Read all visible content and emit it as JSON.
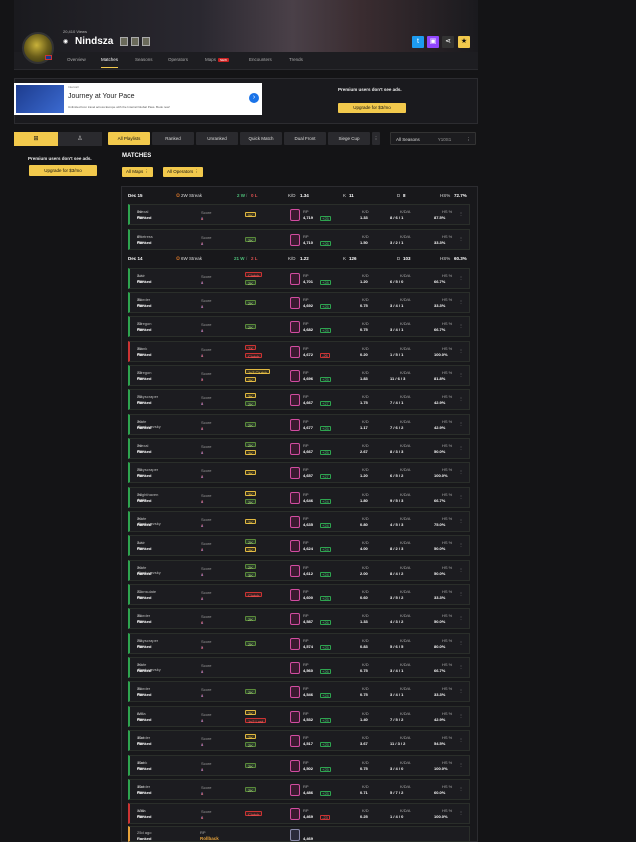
{
  "profile": {
    "views": "20,410 Views",
    "username": "Nindsza",
    "platform_icon": "ubisoft-icon"
  },
  "tabs": [
    "Overview",
    "Matches",
    "Seasons",
    "Operators",
    "Maps",
    "Encounters",
    "Trends"
  ],
  "tab_new_badge": "NEW",
  "ad": {
    "sponsor": "Intercall",
    "headline": "Journey at Your Pace",
    "body": "Unlimited Icon travel across Europe with the Interrail Global Pass. Book now!"
  },
  "premium_text": "Premium users don't see ads.",
  "premium_button": "Upgrade for $3/mo",
  "filters": [
    "All Playlists",
    "Ranked",
    "Unranked",
    "Quick Match",
    "Dual Front",
    "Siege Cup"
  ],
  "season_select": "All Seasons",
  "season_value": "Y10S1",
  "section_title": "MATCHES",
  "chips": [
    "All Maps",
    "All Operators"
  ],
  "day_headers": [
    {
      "date": "Dec 15",
      "streak": "2W Streak",
      "wl_w": "2 W",
      "wl_l": "0 L",
      "kd_label": "K/D",
      "kd": "1.34",
      "k_label": "K",
      "k": "11",
      "d_label": "D",
      "d": "8",
      "hs_label": "HS%",
      "hs": "72.7%"
    },
    {
      "date": "Dec 14",
      "streak": "6W Streak",
      "wl_w": "21 W",
      "wl_l": "2 L",
      "kd_label": "K/D",
      "kd": "1.22",
      "k_label": "K",
      "k": "126",
      "d_label": "D",
      "d": "103",
      "hs_label": "HS%",
      "hs": "60.3%"
    }
  ],
  "labels": {
    "score": "Score",
    "rp": "RP",
    "kd": "K/D",
    "kda": "K/D/A",
    "hs": "HS %"
  },
  "matches": [
    {
      "when": "5d ago",
      "map": "Nexal",
      "mode": "Ranked",
      "s1": "5",
      "s2": "4",
      "tags": [
        [
          "5K",
          "y"
        ]
      ],
      "rp": "4,719",
      "delta": "+25",
      "kd": "1.33",
      "kda": "8 / 6 / 1",
      "hs": "87.5%",
      "result": "win"
    },
    {
      "when": "6d ago",
      "map": "Fortress",
      "mode": "Ranked",
      "s1": "4",
      "s2": "2",
      "tags": [
        [
          "2K",
          "g"
        ]
      ],
      "rp": "4,710",
      "delta": "+26",
      "kd": "1.50",
      "kda": "3 / 2 / 1",
      "hs": "33.3%",
      "result": "win"
    },
    {
      "when": "7d ago",
      "map": "Lair",
      "mode": "Ranked",
      "s1": "4",
      "s2": "1",
      "tags": [
        [
          "Clutch",
          "r"
        ],
        [
          "2K",
          "g"
        ]
      ],
      "rp": "4,701",
      "delta": "+28",
      "kd": "1.20",
      "kda": "6 / 5 / 0",
      "hs": "66.7%",
      "result": "win"
    },
    {
      "when": "7d ago",
      "map": "Border",
      "mode": "Ranked",
      "s1": "4",
      "s2": "1",
      "tags": [
        [
          "2K",
          "g"
        ]
      ],
      "rp": "4,692",
      "delta": "+25",
      "kd": "0.75",
      "kda": "3 / 4 / 1",
      "hs": "33.3%",
      "result": "win"
    },
    {
      "when": "7d ago",
      "map": "Oregon",
      "mode": "Ranked",
      "s1": "4",
      "s2": "1",
      "tags": [
        [
          "2K",
          "g"
        ]
      ],
      "rp": "4,682",
      "delta": "+25",
      "kd": "0.75",
      "kda": "3 / 4 / 1",
      "hs": "66.7%",
      "result": "win"
    },
    {
      "when": "7d ago",
      "map": "Bank",
      "mode": "Ranked",
      "s1": "1",
      "s2": "4",
      "tags": [
        [
          "TK",
          "r"
        ],
        [
          "Clutch",
          "r"
        ]
      ],
      "rp": "4,672",
      "delta": "-26",
      "kd": "0.20",
      "kda": "1 / 5 / 1",
      "hs": "100.0%",
      "result": "loss"
    },
    {
      "when": "7d ago",
      "map": "Oregon",
      "mode": "Ranked",
      "s1": "5",
      "s2": "3",
      "tags": [
        [
          "1v3 Clutch",
          "y"
        ],
        [
          "2K",
          "y"
        ]
      ],
      "rp": "4,696",
      "delta": "+25",
      "kd": "1.83",
      "kda": "11 / 6 / 3",
      "hs": "81.8%",
      "result": "win"
    },
    {
      "when": "7d ago",
      "map": "Skyscraper",
      "mode": "Ranked",
      "s1": "4",
      "s2": "1",
      "tags": [
        [
          "3K",
          "y"
        ],
        [
          "2K",
          "g"
        ]
      ],
      "rp": "4,667",
      "delta": "+27",
      "kd": "1.75",
      "kda": "7 / 4 / 1",
      "hs": "42.9%",
      "result": "win"
    },
    {
      "when": "7d ago",
      "map": "Kafe Dostoyevsky",
      "mode": "Ranked",
      "s1": "4",
      "s2": "3",
      "tags": [
        [
          "2K",
          "g"
        ]
      ],
      "rp": "4,677",
      "delta": "+25",
      "kd": "1.17",
      "kda": "7 / 6 / 2",
      "hs": "42.9%",
      "result": "win"
    },
    {
      "when": "7d ago",
      "map": "Nexal",
      "mode": "Ranked",
      "s1": "4",
      "s2": "1",
      "tags": [
        [
          "2K",
          "g"
        ],
        [
          "2K",
          "y"
        ]
      ],
      "rp": "4,667",
      "delta": "+25",
      "kd": "2.67",
      "kda": "8 / 3 / 3",
      "hs": "50.0%",
      "result": "win"
    },
    {
      "when": "7d ago",
      "map": "Skyscraper",
      "mode": "Ranked",
      "s1": "4",
      "s2": "2",
      "tags": [
        [
          "3K",
          "y"
        ]
      ],
      "rp": "4,657",
      "delta": "+27",
      "kd": "1.20",
      "kda": "6 / 5 / 2",
      "hs": "100.0%",
      "result": "win"
    },
    {
      "when": "7d ago",
      "map": "Nighthaven Labs",
      "mode": "Ranked",
      "s1": "4",
      "s2": "3",
      "tags": [
        [
          "3K",
          "y"
        ],
        [
          "2K",
          "g"
        ]
      ],
      "rp": "4,646",
      "delta": "+24",
      "kd": "1.80",
      "kda": "9 / 5 / 3",
      "hs": "66.7%",
      "result": "win"
    },
    {
      "when": "7d ago",
      "map": "Kafe Dostoyevsky",
      "mode": "Ranked",
      "s1": "4",
      "s2": "2",
      "tags": [
        [
          "2K",
          "y"
        ]
      ],
      "rp": "4,635",
      "delta": "+24",
      "kd": "0.80",
      "kda": "4 / 5 / 3",
      "hs": "75.0%",
      "result": "win"
    },
    {
      "when": "7d ago",
      "map": "Lair",
      "mode": "Ranked",
      "s1": "4",
      "s2": "2",
      "tags": [
        [
          "2K",
          "g"
        ],
        [
          "2K",
          "y"
        ]
      ],
      "rp": "4,624",
      "delta": "+24",
      "kd": "4.00",
      "kda": "8 / 2 / 3",
      "hs": "50.0%",
      "result": "win"
    },
    {
      "when": "7d ago",
      "map": "Kafe Dostoyevsky",
      "mode": "Ranked",
      "s1": "4",
      "s2": "1",
      "tags": [
        [
          "2K",
          "g"
        ],
        [
          "3K",
          "g"
        ]
      ],
      "rp": "4,612",
      "delta": "+24",
      "kd": "2.00",
      "kda": "8 / 4 / 2",
      "hs": "50.0%",
      "result": "win"
    },
    {
      "when": "7d ago",
      "map": "Consulate",
      "mode": "Ranked",
      "s1": "4",
      "s2": "2",
      "tags": [
        [
          "Clutch",
          "r"
        ]
      ],
      "rp": "4,600",
      "delta": "+25",
      "kd": "0.60",
      "kda": "3 / 5 / 2",
      "hs": "33.3%",
      "result": "win"
    },
    {
      "when": "7d ago",
      "map": "Border",
      "mode": "Ranked",
      "s1": "4",
      "s2": "0",
      "tags": [
        [
          "2K",
          "g"
        ]
      ],
      "rp": "4,587",
      "delta": "+26",
      "kd": "1.33",
      "kda": "4 / 3 / 2",
      "hs": "50.0%",
      "result": "win"
    },
    {
      "when": "7d ago",
      "map": "Skyscraper",
      "mode": "Ranked",
      "s1": "5",
      "s2": "3",
      "tags": [
        [
          "2K",
          "g"
        ]
      ],
      "rp": "4,574",
      "delta": "+25",
      "kd": "0.83",
      "kda": "5 / 6 / 5",
      "hs": "80.0%",
      "result": "win"
    },
    {
      "when": "7d ago",
      "map": "Kafe Dostoyevsky",
      "mode": "Ranked",
      "s1": "4",
      "s2": "1",
      "tags": [],
      "rp": "4,560",
      "delta": "+26",
      "kd": "0.75",
      "kda": "3 / 4 / 1",
      "hs": "66.7%",
      "result": "win"
    },
    {
      "when": "7d ago",
      "map": "Border",
      "mode": "Ranked",
      "s1": "4",
      "s2": "1",
      "tags": [
        [
          "2K",
          "g"
        ]
      ],
      "rp": "4,546",
      "delta": "+24",
      "kd": "0.75",
      "kda": "3 / 4 / 1",
      "hs": "33.3%",
      "result": "win"
    },
    {
      "when": "8d ago",
      "map": "Villa",
      "mode": "Ranked",
      "s1": "4",
      "s2": "1",
      "tags": [
        [
          "2K",
          "y"
        ],
        [
          "1v2 Lost",
          "r"
        ]
      ],
      "rp": "4,532",
      "delta": "+25",
      "kd": "1.40",
      "kda": "7 / 5 / 2",
      "hs": "42.9%",
      "result": "win"
    },
    {
      "when": "10d ago",
      "map": "Border",
      "mode": "Ranked",
      "s1": "4",
      "s2": "1",
      "tags": [
        [
          "2K",
          "y"
        ],
        [
          "2K",
          "g"
        ]
      ],
      "rp": "4,517",
      "delta": "+25",
      "kd": "3.67",
      "kda": "11 / 3 / 2",
      "hs": "54.5%",
      "result": "win"
    },
    {
      "when": "10d ago",
      "map": "Bank",
      "mode": "Ranked",
      "s1": "4",
      "s2": "1",
      "tags": [
        [
          "2K",
          "g"
        ]
      ],
      "rp": "4,502",
      "delta": "+25",
      "kd": "0.75",
      "kda": "3 / 4 / 0",
      "hs": "100.0%",
      "result": "win"
    },
    {
      "when": "10d ago",
      "map": "Border",
      "mode": "Ranked",
      "s1": "5",
      "s2": "4",
      "tags": [
        [
          "2K",
          "g"
        ]
      ],
      "rp": "4,486",
      "delta": "+25",
      "kd": "0.71",
      "kda": "5 / 7 / 2",
      "hs": "60.0%",
      "result": "win"
    },
    {
      "when": "10d ago",
      "map": "Villa",
      "mode": "Ranked",
      "s1": "0",
      "s2": "4",
      "tags": [
        [
          "Clutch",
          "r"
        ]
      ],
      "rp": "4,469",
      "delta": "-23",
      "kd": "0.25",
      "kda": "1 / 4 / 0",
      "hs": "100.0%",
      "result": "loss"
    }
  ],
  "last_match": {
    "when": "25d ago",
    "mode": "Ranked",
    "rp_label": "RP",
    "status": "Rollback",
    "rp": "4,469"
  }
}
